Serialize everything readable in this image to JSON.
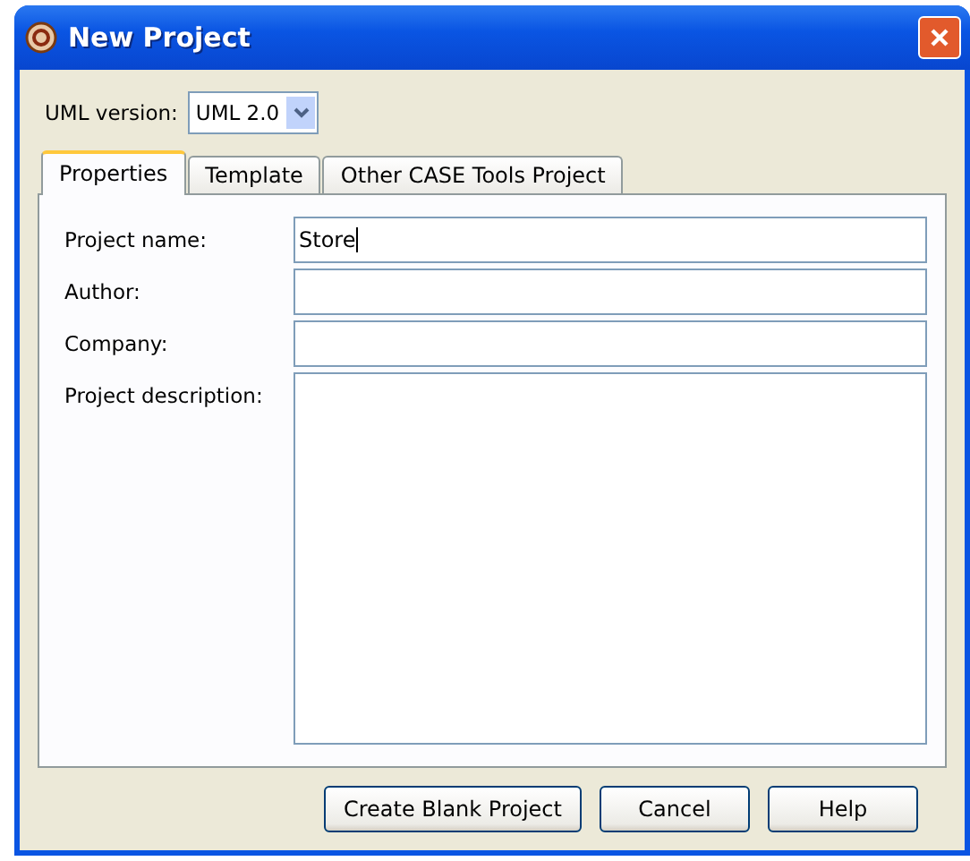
{
  "window": {
    "title": "New Project"
  },
  "uml_version": {
    "label": "UML version:",
    "value": "UML 2.0"
  },
  "tabs": [
    {
      "label": "Properties",
      "selected": true
    },
    {
      "label": "Template",
      "selected": false
    },
    {
      "label": "Other CASE Tools Project",
      "selected": false
    }
  ],
  "fields": [
    {
      "label": "Project name:",
      "value": "Store",
      "kind": "line",
      "focused": true
    },
    {
      "label": "Author:",
      "kind": "line",
      "focused": false
    },
    {
      "label": "Company:",
      "kind": "line",
      "focused": false
    },
    {
      "label": "Project description:",
      "kind": "area",
      "focused": false
    }
  ],
  "buttons": [
    "Create Blank Project",
    "Cancel",
    "Help"
  ]
}
